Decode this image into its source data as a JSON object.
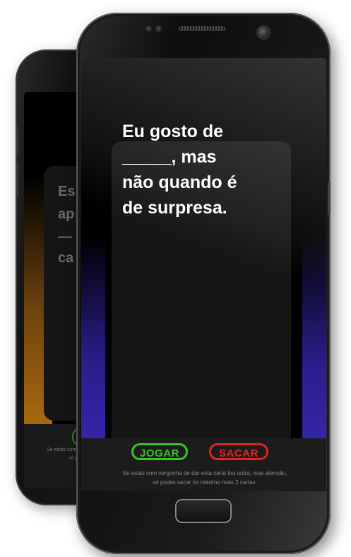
{
  "card": {
    "prompt_lines": [
      "Eu gosto de",
      "_____, mas",
      "não quando é",
      "de surpresa."
    ]
  },
  "actions": {
    "play_label": "JOGAR",
    "draw_label": "SACAR"
  },
  "footer_note": {
    "line1": "Se estás com vergonha de dar esta carta tira outra, mas atenção,",
    "line2": "só podes sacar no máximo mais 2 cartas."
  },
  "back_phone": {
    "visible_fragments": [
      "Es",
      "ap",
      "—",
      "ca"
    ],
    "note_fragments": [
      "Se estás com",
      "só p"
    ]
  },
  "colors": {
    "play_accent": "#39c52a",
    "draw_accent": "#e02424",
    "edge_glow_front": "#3b2bbd",
    "edge_glow_back": "#d9870f",
    "card_bg": "#161616"
  }
}
